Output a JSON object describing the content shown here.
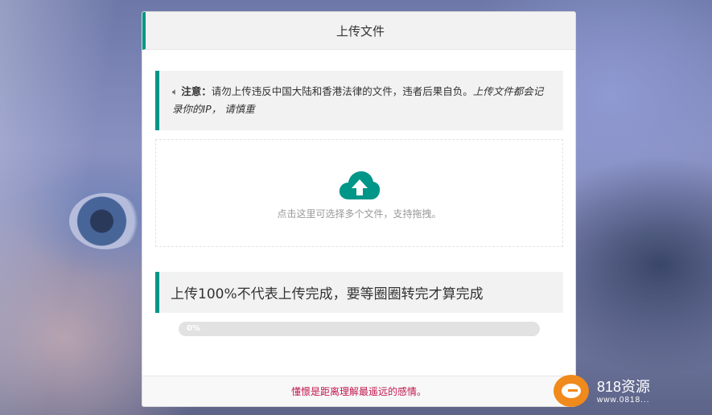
{
  "header": {
    "title": "上传文件"
  },
  "notice": {
    "icon": "speaker-icon",
    "label": "注意：",
    "text": "请勿上传违反中国大陆和香港法律的文件，违者后果自负。",
    "italic": "上传文件都会记录你的IP， 请慎重"
  },
  "dropzone": {
    "icon": "cloud-upload-icon",
    "text": "点击这里可选择多个文件，支持拖拽。"
  },
  "upload": {
    "title": "上传100%不代表上传完成，要等圈圈转完才算完成",
    "progress_percent": 0,
    "progress_text": "0%"
  },
  "footer": {
    "text": "懂憬是距离理解最遥远的感情。"
  },
  "watermark": {
    "name": "818资源",
    "url": "www.0818..."
  },
  "colors": {
    "accent": "#009688",
    "footer_text": "#c0184d"
  }
}
